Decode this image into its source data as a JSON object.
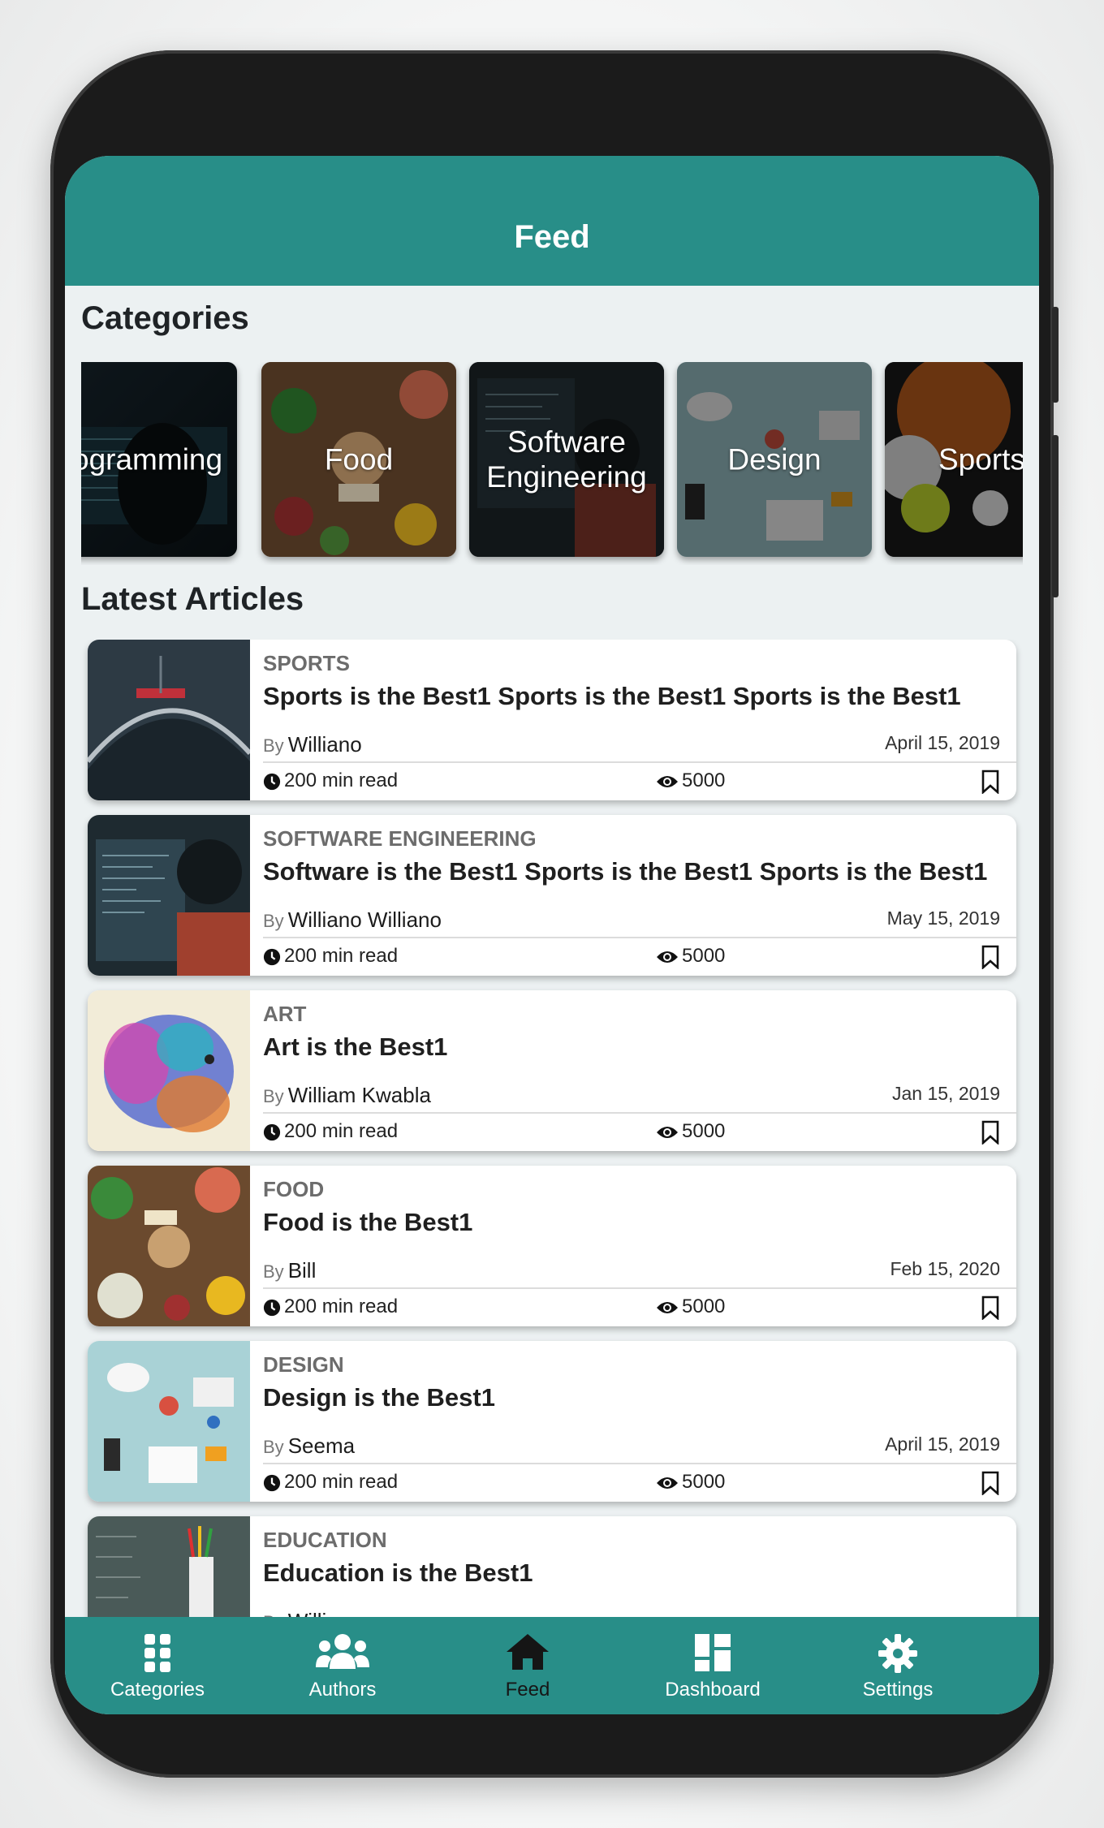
{
  "app": {
    "title": "Feed",
    "colors": {
      "primary": "#288e88",
      "frame": "#1b1b1b",
      "background": "#ecf1f2"
    }
  },
  "categories": {
    "heading": "Categories",
    "items": [
      {
        "label": "Programming"
      },
      {
        "label": "Food"
      },
      {
        "label": "Software\nEngineering"
      },
      {
        "label": "Design"
      },
      {
        "label": "Sports"
      }
    ]
  },
  "latest": {
    "heading": "Latest Articles",
    "articles": [
      {
        "category": "SPORTS",
        "title": "Sports is the Best1 Sports is the Best1 Sports is the Best1",
        "by": "By",
        "author": "Williano",
        "date": "April 15, 2019",
        "read": "200 min read",
        "views": "5000",
        "icon": "bookmark-icon"
      },
      {
        "category": "SOFTWARE ENGINEERING",
        "title": "Software is the Best1 Sports is the Best1 Sports is the Best1",
        "by": "By",
        "author": "Williano Williano",
        "date": "May 15, 2019",
        "read": "200 min read",
        "views": "5000",
        "icon": "bookmark-icon"
      },
      {
        "category": "ART",
        "title": "Art is the Best1",
        "by": "By",
        "author": "William Kwabla",
        "date": "Jan 15, 2019",
        "read": "200 min read",
        "views": "5000",
        "icon": "bookmark-icon"
      },
      {
        "category": "FOOD",
        "title": "Food is the Best1",
        "by": "By",
        "author": "Bill",
        "date": "Feb 15, 2020",
        "read": "200 min read",
        "views": "5000",
        "icon": "bookmark-icon"
      },
      {
        "category": "DESIGN",
        "title": "Design is the Best1",
        "by": "By",
        "author": "Seema",
        "date": "April 15, 2019",
        "read": "200 min read",
        "views": "5000",
        "icon": "bookmark-icon"
      },
      {
        "category": "EDUCATION",
        "title": "Education is the Best1",
        "by": "By",
        "author": "Williano",
        "date": "",
        "read": "",
        "views": "",
        "icon": "bookmark-icon"
      }
    ]
  },
  "nav": {
    "items": [
      {
        "label": "Categories",
        "icon": "grid-icon",
        "active": false
      },
      {
        "label": "Authors",
        "icon": "people-icon",
        "active": false
      },
      {
        "label": "Feed",
        "icon": "home-icon",
        "active": true
      },
      {
        "label": "Dashboard",
        "icon": "dashboard-icon",
        "active": false
      },
      {
        "label": "Settings",
        "icon": "gear-icon",
        "active": false
      }
    ]
  }
}
